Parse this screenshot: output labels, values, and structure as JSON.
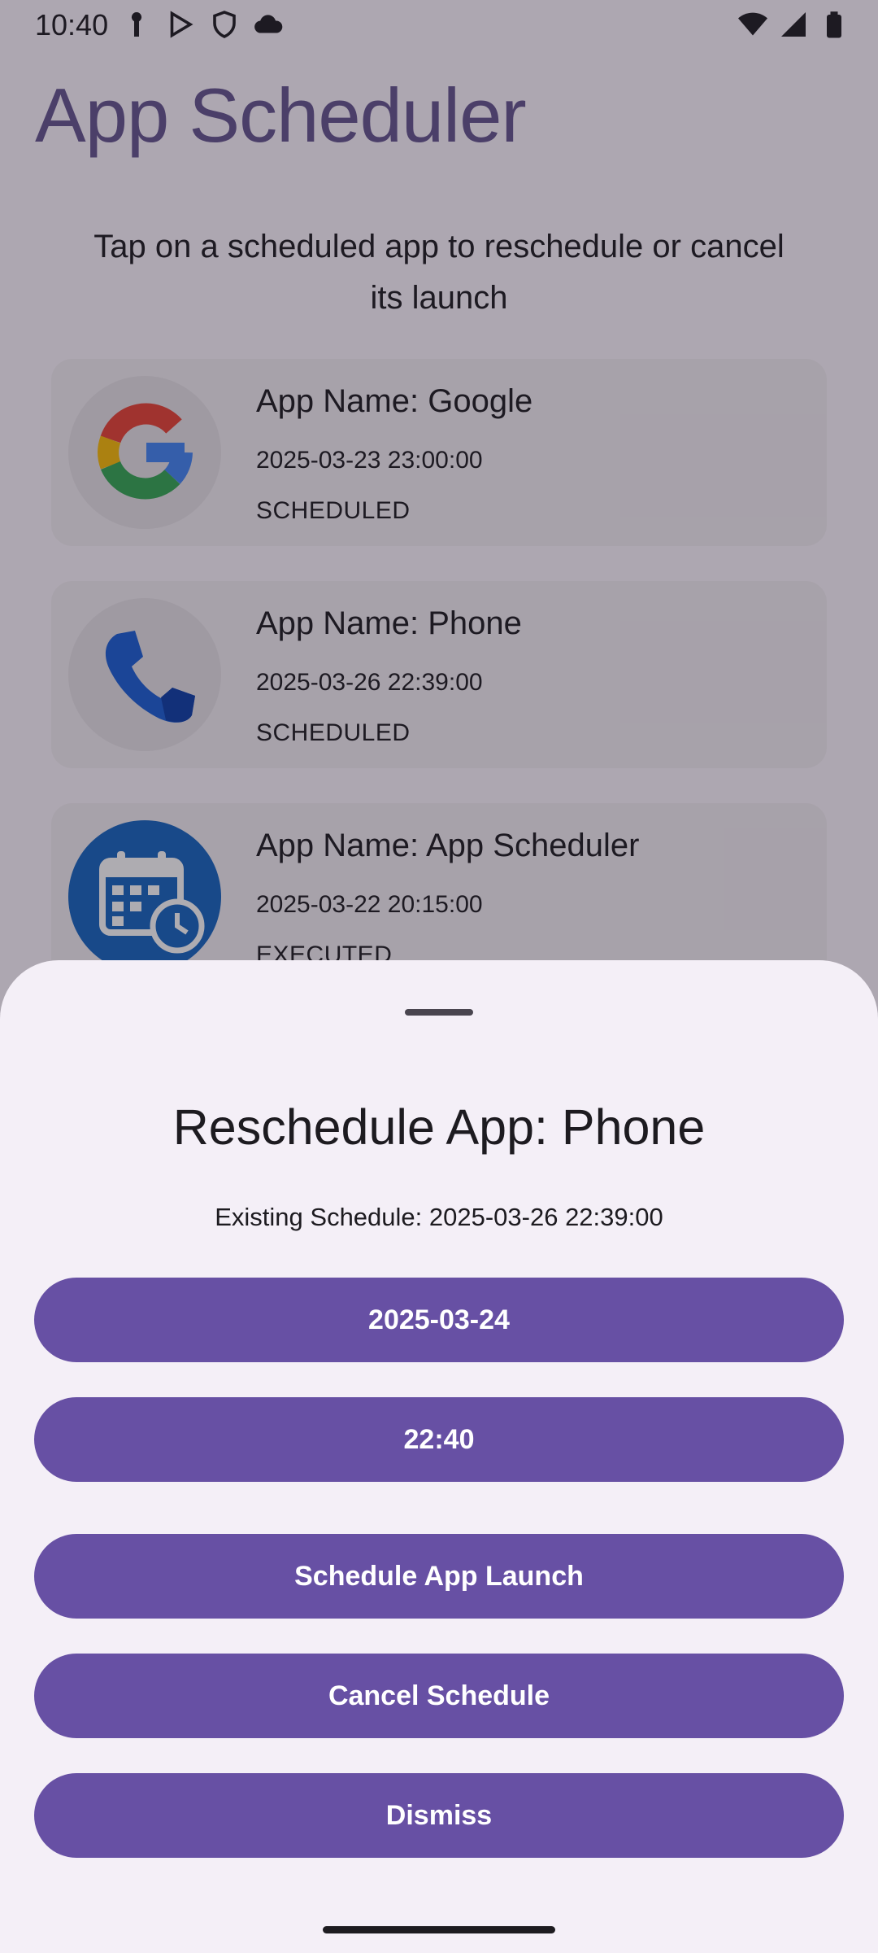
{
  "status_bar": {
    "time": "10:40",
    "left_icons": [
      "notification-key-icon",
      "play-store-icon",
      "shield-icon",
      "cloud-icon"
    ],
    "right_icons": [
      "wifi-icon",
      "signal-icon",
      "battery-icon"
    ]
  },
  "app": {
    "title": "App Scheduler",
    "instruction": "Tap on a scheduled app to reschedule or cancel its launch",
    "accent_color": "#65558f"
  },
  "schedules": [
    {
      "name": "App Name: Google",
      "datetime": "2025-03-23 23:00:00",
      "status": "SCHEDULED",
      "icon": "google-icon"
    },
    {
      "name": "App Name: Phone",
      "datetime": "2025-03-26 22:39:00",
      "status": "SCHEDULED",
      "icon": "phone-icon"
    },
    {
      "name": "App Name: App Scheduler",
      "datetime": "2025-03-22 20:15:00",
      "status": "EXECUTED",
      "icon": "calendar-clock-icon"
    }
  ],
  "sheet": {
    "title": "Reschedule App: Phone",
    "existing": "Existing Schedule: 2025-03-26 22:39:00",
    "date_button": "2025-03-24",
    "time_button": "22:40",
    "schedule_button": "Schedule App Launch",
    "cancel_button": "Cancel Schedule",
    "dismiss_button": "Dismiss",
    "button_color": "#6750a4"
  }
}
